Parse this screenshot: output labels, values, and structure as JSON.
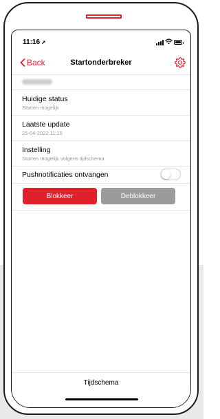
{
  "status_bar": {
    "time": "11:16",
    "location_icon": "location-arrow-icon",
    "icons": [
      "signal-icon",
      "wifi-icon",
      "battery-icon"
    ]
  },
  "nav": {
    "back_label": "Back",
    "title": "Startonderbreker",
    "settings_icon": "gear-icon"
  },
  "vehicle": {
    "plate_redacted": true
  },
  "rows": [
    {
      "label": "Huidige status",
      "value": "Starten mogelijk"
    },
    {
      "label": "Laatste update",
      "value": "25-04-2022 11:15"
    },
    {
      "label": "Instelling",
      "value": "Starten mogelijk volgens tijdschema"
    }
  ],
  "push": {
    "label": "Pushnotificaties ontvangen",
    "enabled": false
  },
  "actions": {
    "block_label": "Blokkeer",
    "unblock_label": "Deblokkeer"
  },
  "tab_bar": {
    "label": "Tijdschema"
  },
  "colors": {
    "accent": "#e0202a",
    "disabled_button": "#9b9b9b",
    "secondary_text": "#9a9a9a",
    "separator": "#e6e6e6",
    "frame": "#1b1b1b",
    "background_band": "#e9e9ec"
  }
}
